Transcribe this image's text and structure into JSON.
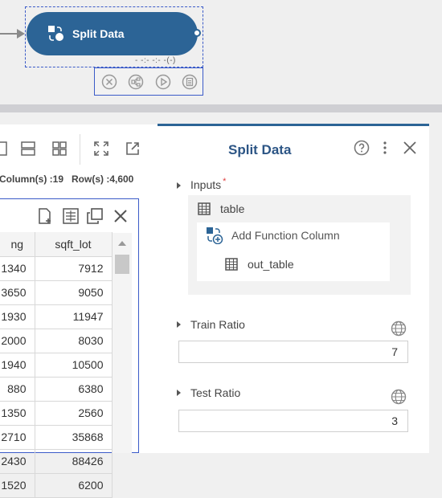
{
  "canvas": {
    "node": {
      "label": "Split Data",
      "status": "- -:- -:- -(-)"
    }
  },
  "data_view": {
    "column_count": "Column(s) :19",
    "row_count": "Row(s) :4,600",
    "columns": [
      "ng",
      "sqft_lot"
    ],
    "rows": [
      [
        "1340",
        "7912"
      ],
      [
        "3650",
        "9050"
      ],
      [
        "1930",
        "11947"
      ],
      [
        "2000",
        "8030"
      ],
      [
        "1940",
        "10500"
      ],
      [
        "880",
        "6380"
      ],
      [
        "1350",
        "2560"
      ],
      [
        "2710",
        "35868"
      ],
      [
        "2430",
        "88426"
      ],
      [
        "1520",
        "6200"
      ]
    ]
  },
  "properties": {
    "title": "Split Data",
    "inputs": {
      "label": "Inputs",
      "required_mark": "*",
      "table": "table",
      "add_function": "Add Function Column",
      "out_table": "out_table"
    },
    "train_ratio": {
      "label": "Train Ratio",
      "value": "7"
    },
    "test_ratio": {
      "label": "Test Ratio",
      "value": "3"
    }
  },
  "colors": {
    "accent": "#2c6496",
    "selection": "#3b5bc8",
    "title": "#2c5585"
  }
}
